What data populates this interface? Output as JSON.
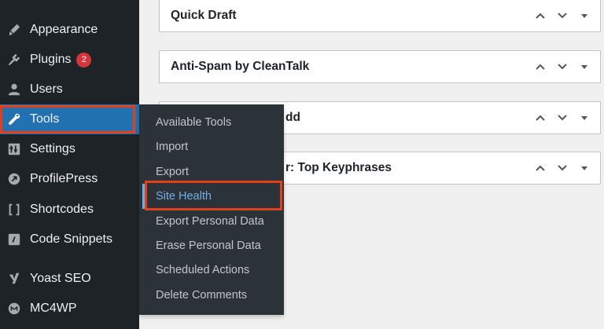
{
  "sidebar": {
    "items": [
      {
        "label": "Appearance",
        "icon": "paintbrush-icon"
      },
      {
        "label": "Plugins",
        "icon": "plugin-icon",
        "badge": "2"
      },
      {
        "label": "Users",
        "icon": "user-icon"
      },
      {
        "label": "Tools",
        "icon": "wrench-icon"
      },
      {
        "label": "Settings",
        "icon": "sliders-icon"
      },
      {
        "label": "ProfilePress",
        "icon": "profilepress-icon"
      },
      {
        "label": "Shortcodes",
        "icon": "brackets-icon"
      },
      {
        "label": "Code Snippets",
        "icon": "code-icon"
      },
      {
        "label": "Yoast SEO",
        "icon": "yoast-icon"
      },
      {
        "label": "MC4WP",
        "icon": "mc4wp-icon"
      }
    ]
  },
  "submenu": {
    "items": [
      {
        "label": "Available Tools"
      },
      {
        "label": "Import"
      },
      {
        "label": "Export"
      },
      {
        "label": "Site Health"
      },
      {
        "label": "Export Personal Data"
      },
      {
        "label": "Erase Personal Data"
      },
      {
        "label": "Scheduled Actions"
      },
      {
        "label": "Delete Comments"
      }
    ]
  },
  "widgets": [
    {
      "title": "Quick Draft"
    },
    {
      "title": "Anti-Spam by CleanTalk"
    },
    {
      "title": "dd"
    },
    {
      "title": "r: Top Keyphrases"
    }
  ],
  "colors": {
    "sidebar_bg": "#1d2327",
    "submenu_bg": "#2c3338",
    "highlight": "#e2401c",
    "accent": "#72aee6",
    "badge": "#d63638"
  }
}
